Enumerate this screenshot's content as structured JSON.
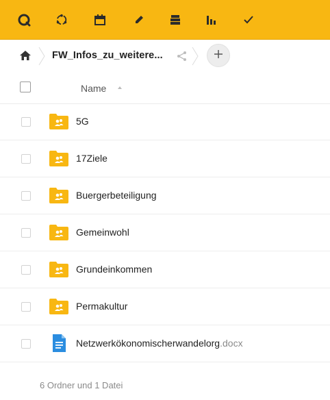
{
  "toolbar": {
    "items": [
      {
        "name": "search-icon"
      },
      {
        "name": "sync-icon"
      },
      {
        "name": "calendar-icon"
      },
      {
        "name": "pencil-icon"
      },
      {
        "name": "archive-icon"
      },
      {
        "name": "bar-chart-icon"
      },
      {
        "name": "checkmark-icon"
      }
    ],
    "color": "#f8b712"
  },
  "breadcrumb": {
    "home_icon": "home-icon",
    "folder": "FW_Infos_zu_weitere...",
    "share_icon": "share-icon",
    "add_icon": "plus-icon"
  },
  "list": {
    "column_name": "Name",
    "rows": [
      {
        "name": "5G",
        "ext": "",
        "type": "shared-folder"
      },
      {
        "name": "17Ziele",
        "ext": "",
        "type": "shared-folder"
      },
      {
        "name": "Buergerbeteiligung",
        "ext": "",
        "type": "shared-folder"
      },
      {
        "name": "Gemeinwohl",
        "ext": "",
        "type": "shared-folder"
      },
      {
        "name": "Grundeinkommen",
        "ext": "",
        "type": "shared-folder"
      },
      {
        "name": "Permakultur",
        "ext": "",
        "type": "shared-folder"
      },
      {
        "name": "Netzwerkökonomischerwandelorg",
        "ext": ".docx",
        "type": "document"
      }
    ],
    "summary": "6 Ordner und 1 Datei"
  },
  "colors": {
    "folder": "#f8b712",
    "document": "#2b8de0",
    "accent": "#f8b712"
  }
}
